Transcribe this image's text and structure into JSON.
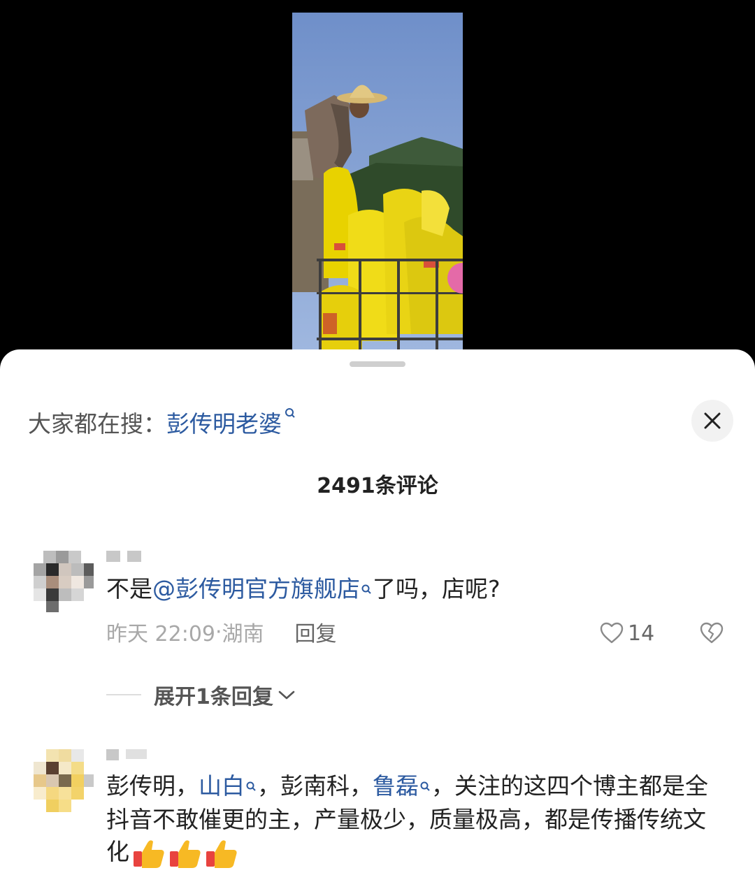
{
  "search": {
    "prefix": "大家都在搜：",
    "term": "彭传明老婆"
  },
  "comments_header": {
    "count_label": "2491条评论"
  },
  "comments": [
    {
      "text_before": "不是",
      "mention": "@彭传明官方旗舰店",
      "text_after": "了吗，店呢?",
      "time": "昨天 22:09",
      "location_sep": "·",
      "location": "湖南",
      "reply_label": "回复",
      "likes": "14",
      "expand_label": "展开1条回复"
    },
    {
      "part1": "彭传明，",
      "link1": "山白",
      "part2": "，彭南科，",
      "link2": "鲁磊",
      "part3": "，关注的这四个博主都是全抖音不敢催更的主，产量极少，质量极高，都是传播传统文化"
    }
  ],
  "colors": {
    "link": "#2c5aa0",
    "sheet_bg": "#ffffff",
    "page_bg": "#000000",
    "meta_gray": "#a8a8a8"
  },
  "icons": [
    "search-hint-icon",
    "close-icon",
    "heart-icon",
    "broken-heart-icon",
    "chevron-down-icon",
    "thumbs-up-emoji"
  ]
}
